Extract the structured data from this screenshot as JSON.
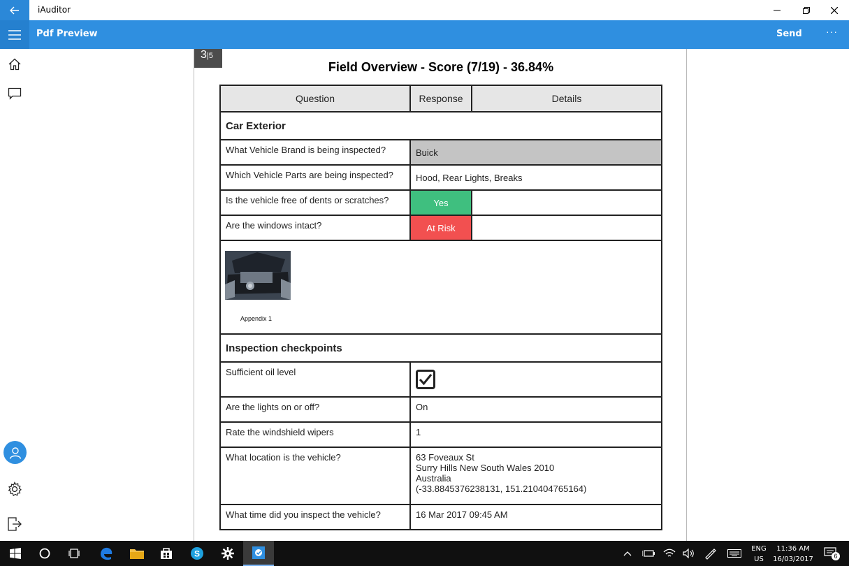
{
  "window": {
    "app_title": "iAuditor"
  },
  "appbar": {
    "title": "Pdf Preview",
    "send_label": "Send",
    "more_label": "···"
  },
  "page_indicator": {
    "current": "3",
    "total": "5"
  },
  "report": {
    "title": "Field Overview - Score  (7/19) - 36.84%",
    "headers": [
      "Question",
      "Response",
      "Details"
    ],
    "sections": [
      {
        "title": "Car Exterior",
        "rows": [
          {
            "question": "What Vehicle Brand is being inspected?",
            "response": "Buick"
          },
          {
            "question": "Which Vehicle Parts are being inspected?",
            "response": "Hood, Rear Lights, Breaks"
          },
          {
            "question": "Is the vehicle free of dents or scratches?",
            "response": "Yes",
            "response_color": "#3fbf7f"
          },
          {
            "question": "Are the windows intact?",
            "response": "At Risk",
            "response_color": "#f25050"
          }
        ],
        "photo_caption": "Appendix 1"
      },
      {
        "title": "Inspection checkpoints",
        "rows": [
          {
            "question": "Sufficient oil level",
            "response": "checked"
          },
          {
            "question": "Are the lights on or off?",
            "response": "On"
          },
          {
            "question": "Rate the windshield wipers",
            "response": "1"
          },
          {
            "question": "What location is the vehicle?",
            "response": "63 Foveaux St\nSurry Hills New South Wales 2010\nAustralia\n(-33.8845376238131, 151.210404765164)"
          },
          {
            "question": "What time did you inspect the vehicle?",
            "response": "16 Mar 2017 09:45 AM"
          }
        ]
      }
    ]
  },
  "taskbar": {
    "language": "ENG",
    "region": "US",
    "time": "11:36 AM",
    "date": "16/03/2017",
    "notification_count": "6"
  },
  "colors": {
    "accent": "#2f8fe0",
    "yes": "#3fbf7f",
    "at_risk": "#f25050"
  }
}
